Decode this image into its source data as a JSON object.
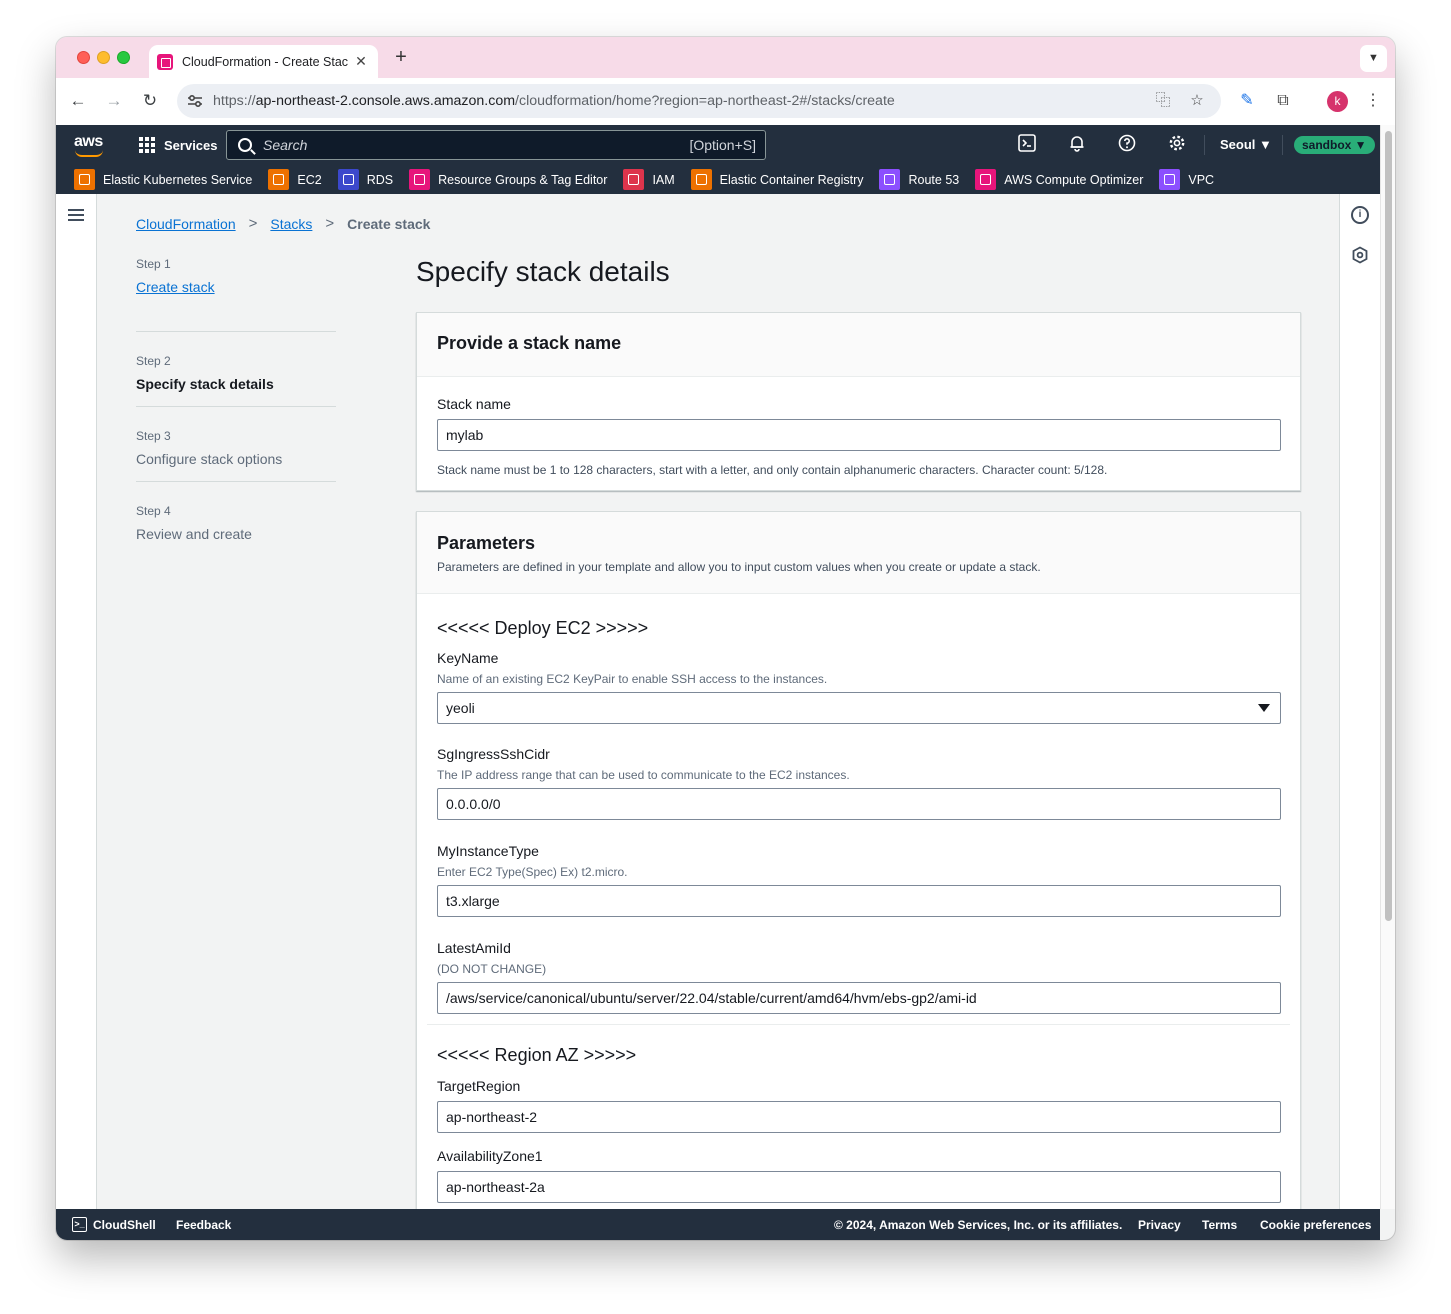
{
  "browser": {
    "tab_title": "CloudFormation - Create Stac",
    "url_prefix": "https://",
    "url_host": "ap-northeast-2.console.aws.amazon.com",
    "url_path": "/cloudformation/home?region=ap-northeast-2#/stacks/create",
    "profile_initial": "k"
  },
  "aws_nav": {
    "logo": "aws",
    "services_label": "Services",
    "search_placeholder": "Search",
    "search_shortcut": "[Option+S]",
    "region": "Seoul ▼",
    "account_badge": "sandbox ▼",
    "favorites": [
      {
        "label": "Elastic Kubernetes Service",
        "color": "#ed7100"
      },
      {
        "label": "EC2",
        "color": "#ed7100"
      },
      {
        "label": "RDS",
        "color": "#3b48cc"
      },
      {
        "label": "Resource Groups & Tag Editor",
        "color": "#e7157b"
      },
      {
        "label": "IAM",
        "color": "#dd344c"
      },
      {
        "label": "Elastic Container Registry",
        "color": "#ed7100"
      },
      {
        "label": "Route 53",
        "color": "#8c4fff"
      },
      {
        "label": "AWS Compute Optimizer",
        "color": "#e7157b"
      },
      {
        "label": "VPC",
        "color": "#8c4fff"
      }
    ]
  },
  "breadcrumb": {
    "items": [
      "CloudFormation",
      "Stacks"
    ],
    "current": "Create stack"
  },
  "steps": [
    {
      "num": "Step 1",
      "label": "Create stack"
    },
    {
      "num": "Step 2",
      "label": "Specify stack details"
    },
    {
      "num": "Step 3",
      "label": "Configure stack options"
    },
    {
      "num": "Step 4",
      "label": "Review and create"
    }
  ],
  "page_title": "Specify stack details",
  "stack_name_section": {
    "title": "Provide a stack name",
    "field_label": "Stack name",
    "value": "mylab",
    "hint": "Stack name must be 1 to 128 characters, start with a letter, and only contain alphanumeric characters. Character count: 5/128."
  },
  "parameters_section": {
    "title": "Parameters",
    "description": "Parameters are defined in your template and allow you to input custom values when you create or update a stack.",
    "group1_title": "<<<<< Deploy EC2 >>>>>",
    "key_name": {
      "label": "KeyName",
      "desc": "Name of an existing EC2 KeyPair to enable SSH access to the instances.",
      "value": "yeoli"
    },
    "ssh_cidr": {
      "label": "SgIngressSshCidr",
      "desc": "The IP address range that can be used to communicate to the EC2 instances.",
      "value": "0.0.0.0/0"
    },
    "instance_type": {
      "label": "MyInstanceType",
      "desc": "Enter EC2 Type(Spec) Ex) t2.micro.",
      "value": "t3.xlarge"
    },
    "ami_id": {
      "label": "LatestAmiId",
      "desc": "(DO NOT CHANGE)",
      "value": "/aws/service/canonical/ubuntu/server/22.04/stable/current/amd64/hvm/ebs-gp2/ami-id"
    },
    "group2_title": "<<<<< Region AZ >>>>>",
    "target_region": {
      "label": "TargetRegion",
      "value": "ap-northeast-2"
    },
    "az1": {
      "label": "AvailabilityZone1",
      "value": "ap-northeast-2a"
    }
  },
  "footer": {
    "cloudshell": "CloudShell",
    "feedback": "Feedback",
    "copyright": "© 2024, Amazon Web Services, Inc. or its affiliates.",
    "privacy": "Privacy",
    "terms": "Terms",
    "cookie": "Cookie preferences"
  }
}
